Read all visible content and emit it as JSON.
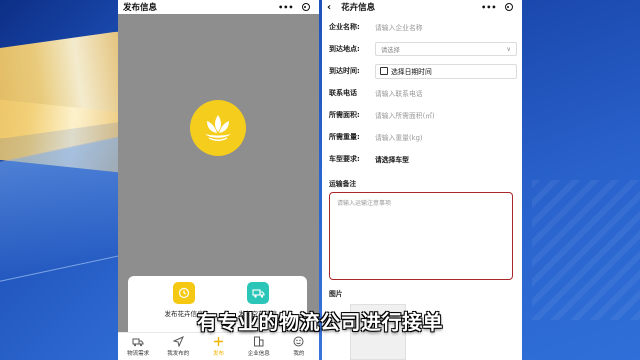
{
  "left_screen": {
    "title": "发布信息",
    "capsule_more": "•••",
    "publish_buttons": [
      {
        "label": "发布花卉信息",
        "icon": "flower-clock-icon"
      },
      {
        "label": "发布空车信息",
        "icon": "truck-icon"
      }
    ],
    "tabbar": [
      {
        "label": "物流需求",
        "icon": "truck-outline-icon"
      },
      {
        "label": "我发布的",
        "icon": "send-icon"
      },
      {
        "label": "发布",
        "icon": "plus-icon",
        "active": true
      },
      {
        "label": "企业信息",
        "icon": "building-icon"
      },
      {
        "label": "我的",
        "icon": "smile-icon"
      }
    ],
    "accent": "#f4cd1d"
  },
  "right_screen": {
    "title": "花卉信息",
    "capsule_more": "•••",
    "fields": {
      "company_label": "企业名称:",
      "company_placeholder": "请输入企业名称",
      "destination_label": "到达地点:",
      "destination_placeholder": "请选择",
      "arrival_label": "到达时间:",
      "arrival_value": "选择日期时间",
      "phone_label": "联系电话",
      "phone_placeholder": "请输入联系电话",
      "area_label": "所需面积:",
      "area_placeholder": "请输入所需面积(㎡)",
      "weight_label": "所需重量:",
      "weight_placeholder": "请输入重量(kg)",
      "vehicle_label": "车型要求:",
      "vehicle_value": "请选择车型",
      "notes_label": "运输备注",
      "notes_placeholder": "请输入运输注意事项",
      "image_label": "图片"
    },
    "border_accent": "#aa2727"
  },
  "subtitle": "有专业的物流公司进行接单"
}
